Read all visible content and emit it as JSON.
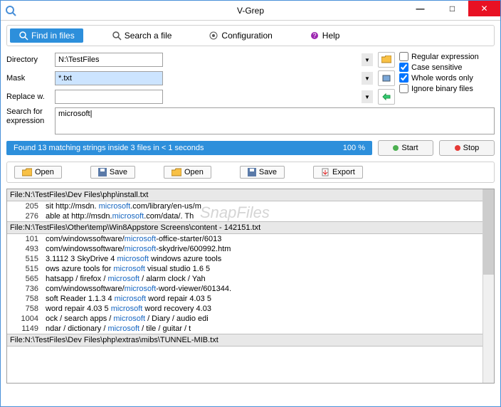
{
  "window": {
    "title": "V-Grep"
  },
  "toolbar": {
    "find_files": "Find in files",
    "search_file": "Search a file",
    "configuration": "Configuration",
    "help": "Help"
  },
  "labels": {
    "directory": "Directory",
    "mask": "Mask",
    "replace_w": "Replace w.",
    "search_for": "Search for expression"
  },
  "inputs": {
    "directory": "N:\\TestFiles",
    "mask": "*.txt",
    "replace": "",
    "search": "microsoft"
  },
  "checks": {
    "regex": "Regular expression",
    "case": "Case sensitive",
    "whole": "Whole words only",
    "ignore": "Ignore binary files"
  },
  "status": {
    "left": "Found 13 matching strings inside 3 files in < 1 seconds",
    "right": "100 %"
  },
  "buttons": {
    "start": "Start",
    "stop": "Stop",
    "open1": "Open",
    "save1": "Save",
    "open2": "Open",
    "save2": "Save",
    "export": "Export"
  },
  "results": [
    {
      "type": "file",
      "text": "File:N:\\TestFiles\\Dev Files\\php\\install.txt"
    },
    {
      "type": "line",
      "no": "205",
      "pre": "sit   http://msdn.  ",
      "hl": "microsoft",
      "post": ".com/library/en-us/m"
    },
    {
      "type": "line",
      "no": "276",
      "pre": "able at http://msdn.",
      "hl": "microsoft",
      "post": ".com/data/.    Th"
    },
    {
      "type": "file",
      "text": "File:N:\\TestFiles\\Other\\temp\\Win8Appstore Screens\\content - 142151.txt"
    },
    {
      "type": "line",
      "no": "101",
      "pre": "com/windowssoftware/",
      "hl": "microsoft",
      "post": "-office-starter/6013"
    },
    {
      "type": "line",
      "no": "493",
      "pre": "com/windowssoftware/",
      "hl": "microsoft",
      "post": "-skydrive/600992.htm"
    },
    {
      "type": "line",
      "no": "515",
      "pre": "3.1112 3 SkyDrive 4 ",
      "hl": "microsoft",
      "post": " windows azure tools"
    },
    {
      "type": "line",
      "no": "515",
      "pre": "ows azure tools for ",
      "hl": "microsoft",
      "post": " visual studio 1.6 5"
    },
    {
      "type": "line",
      "no": "565",
      "pre": "hatsapp / firefox / ",
      "hl": "microsoft",
      "post": " / alarm clock / Yah"
    },
    {
      "type": "line",
      "no": "736",
      "pre": "com/windowssoftware/",
      "hl": "microsoft",
      "post": "-word-viewer/601344."
    },
    {
      "type": "line",
      "no": "758",
      "pre": "soft Reader 1.1.3 4 ",
      "hl": "microsoft",
      "post": " word repair 4.03 5"
    },
    {
      "type": "line",
      "no": "758",
      "pre": " word repair 4.03 5 ",
      "hl": "microsoft",
      "post": " word recovery 4.03"
    },
    {
      "type": "line",
      "no": "1004",
      "pre": "ock / search apps / ",
      "hl": "microsoft",
      "post": " / Diary / audio edi"
    },
    {
      "type": "line",
      "no": "1149",
      "pre": "ndar / dictionary / ",
      "hl": "microsoft",
      "post": " / tile / guitar / t"
    },
    {
      "type": "file",
      "text": "File:N:\\TestFiles\\Dev Files\\php\\extras\\mibs\\TUNNEL-MIB.txt"
    }
  ],
  "watermark": "SnapFiles"
}
